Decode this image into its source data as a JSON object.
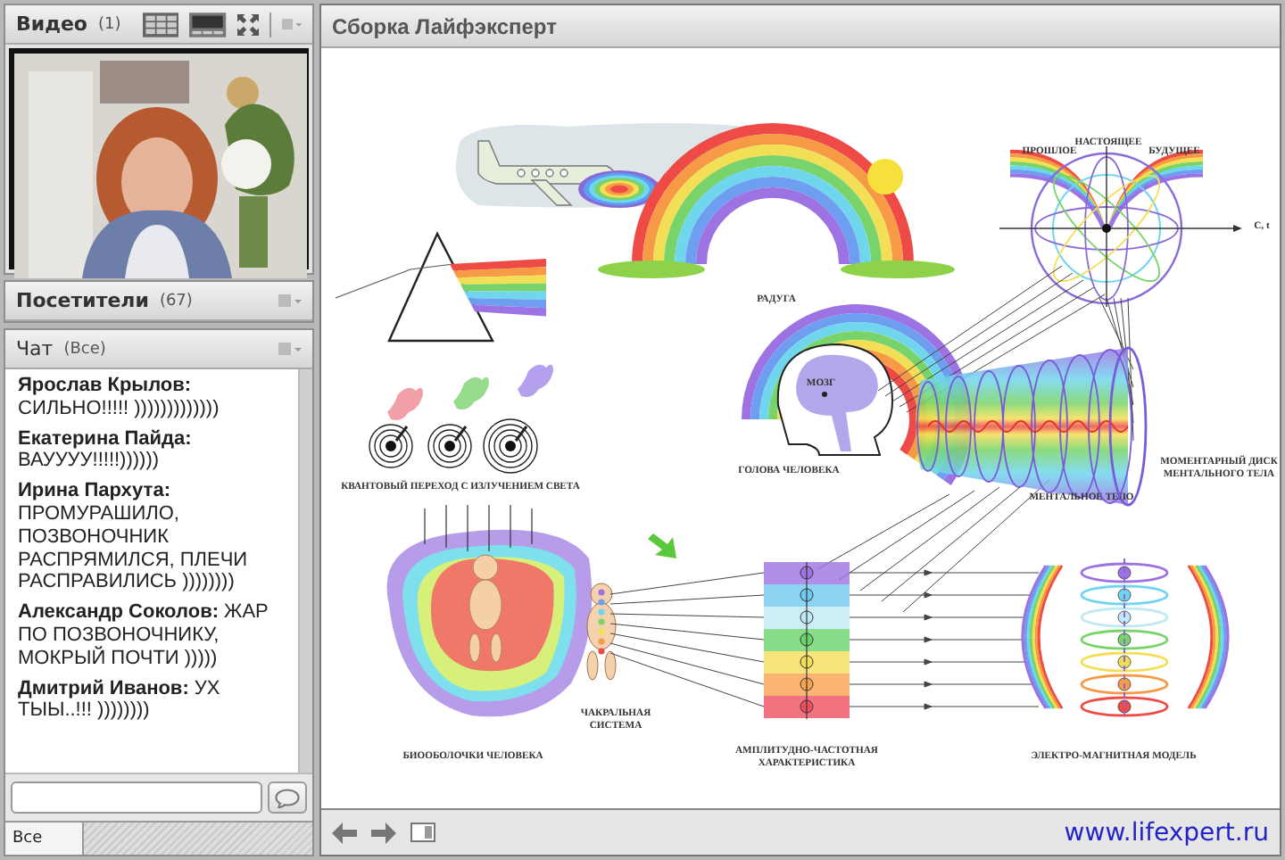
{
  "video_panel": {
    "title": "Видео",
    "count": "(1)"
  },
  "attendees_panel": {
    "title": "Посетители",
    "count": "(67)"
  },
  "chat_panel": {
    "title": "Чат",
    "scope": "(Все)",
    "messages": [
      {
        "text": "**Ярослав Крылов:** СИЛЬНО!!!!! )))))))))))))"
      },
      {
        "text": "**Екатерина Пайда:** ВАУУУУ!!!!!))))))"
      },
      {
        "text": "**Ирина Пархута:** ПРОМУРАШИЛО, ПОЗВОНОЧНИК РАСПРЯМИЛСЯ, ПЛЕЧИ РАСПРАВИЛИСЬ ))))))))"
      },
      {
        "text": "**Александр Соколов:** ЖАР ПО ПОЗВОНОЧНИКУ, МОКРЫЙ ПОЧТИ )))))"
      },
      {
        "text": "**Дмитрий Иванов:** УХ ТЫЫ..!!! ))))))))"
      }
    ],
    "recipient_tab": "Все"
  },
  "share_panel": {
    "title": "Сборка Лайфэксперт",
    "slide_labels": [
      {
        "text": "РАДУГА"
      },
      {
        "text": "ПРОШЛОЕ"
      },
      {
        "text": "НАСТОЯЩЕЕ"
      },
      {
        "text": "БУДУЩЕЕ"
      },
      {
        "text": "C, t"
      },
      {
        "text": "МОЗГ"
      },
      {
        "text": "ГОЛОВА ЧЕЛОВЕКА"
      },
      {
        "text": "МОМЕНТАРНЫЙ ДИСК МЕНТАЛЬНОГО ТЕЛА"
      },
      {
        "text": "МЕНТАЛЬНОЕ ТЕЛО"
      },
      {
        "text": "КВАНТОВЫЙ ПЕРЕХОД С ИЗЛУЧЕНИЕМ СВЕТА"
      },
      {
        "text": "ЧАКРАЛЬНАЯ СИСТЕМА"
      },
      {
        "text": "БИООБОЛОЧКИ ЧЕЛОВЕКА"
      },
      {
        "text": "АМПЛИТУДНО-ЧАСТОТНАЯ ХАРАКТЕРИСТИКА"
      },
      {
        "text": "ЭЛЕКТРО-МАГНИТНАЯ МОДЕЛЬ"
      }
    ],
    "footer_link": "www.lifexpert.ru"
  }
}
